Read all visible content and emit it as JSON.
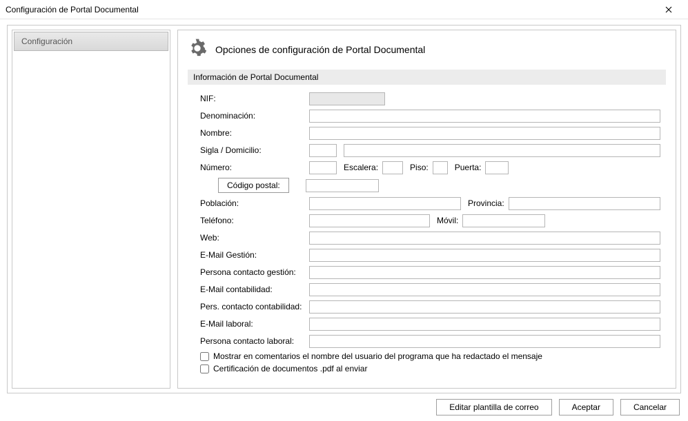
{
  "window": {
    "title": "Configuración de Portal Documental"
  },
  "sidebar": {
    "tab": "Configuración"
  },
  "main": {
    "heading": "Opciones de configuración de Portal Documental",
    "section": "Información de Portal Documental",
    "labels": {
      "nif": "NIF:",
      "denominacion": "Denominación:",
      "nombre": "Nombre:",
      "sigla_domicilio": "Sigla / Domicilio:",
      "numero": "Número:",
      "escalera": "Escalera:",
      "piso": "Piso:",
      "puerta": "Puerta:",
      "codigo_postal": "Código postal:",
      "poblacion": "Población:",
      "provincia": "Provincia:",
      "telefono": "Teléfono:",
      "movil": "Móvil:",
      "web": "Web:",
      "email_gestion": "E-Mail Gestión:",
      "persona_gestion": "Persona contacto gestión:",
      "email_contabilidad": "E-Mail contabilidad:",
      "persona_contabilidad": "Pers. contacto contabilidad:",
      "email_laboral": "E-Mail laboral:",
      "persona_laboral": "Persona contacto laboral:"
    },
    "values": {
      "nif": "",
      "denominacion": "",
      "nombre": "",
      "sigla": "",
      "domicilio": "",
      "numero": "",
      "escalera": "",
      "piso": "",
      "puerta": "",
      "codigo_postal": "",
      "poblacion": "",
      "provincia": "",
      "telefono": "",
      "movil": "",
      "web": "",
      "email_gestion": "",
      "persona_gestion": "",
      "email_contabilidad": "",
      "persona_contabilidad": "",
      "email_laboral": "",
      "persona_laboral": ""
    },
    "checkboxes": {
      "mostrar_comentarios": {
        "label": "Mostrar en comentarios el nombre del usuario del programa que ha redactado el mensaje",
        "checked": false
      },
      "certificacion": {
        "label": "Certificación de documentos .pdf al enviar",
        "checked": false
      }
    }
  },
  "footer": {
    "editar": "Editar plantilla de correo",
    "aceptar": "Aceptar",
    "cancelar": "Cancelar"
  }
}
